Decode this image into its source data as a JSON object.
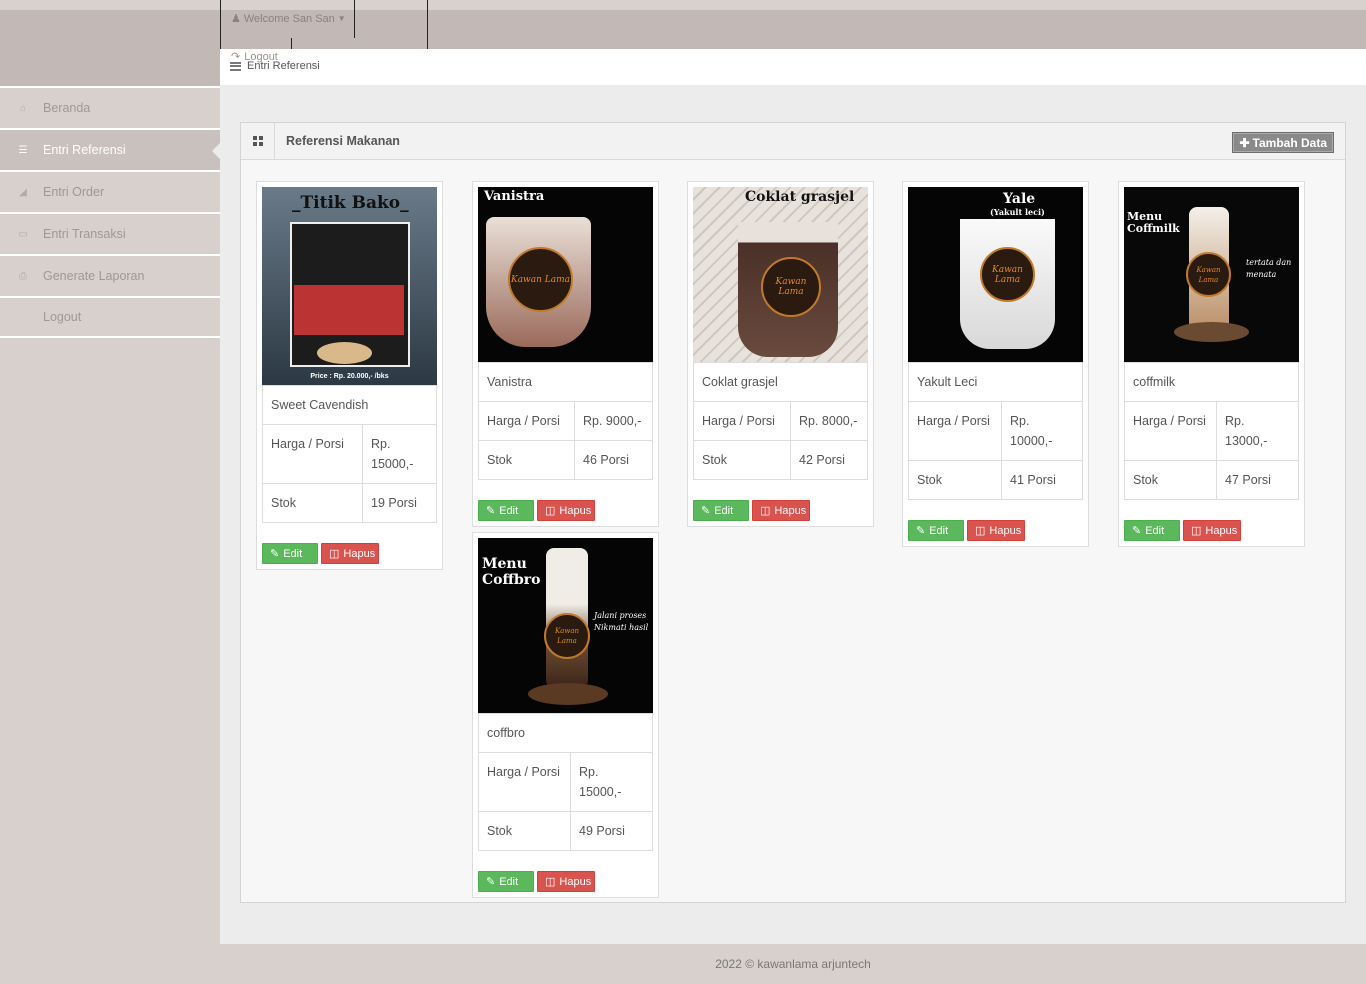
{
  "header": {
    "welcome": "Welcome San San",
    "logout": "Logout",
    "breadcrumb": "Entri Referensi"
  },
  "sidebar": {
    "items": [
      {
        "label": "Beranda",
        "icon": "home-icon"
      },
      {
        "label": "Entri Referensi",
        "icon": "list-icon",
        "active": true
      },
      {
        "label": "Entri Order",
        "icon": "cart-icon"
      },
      {
        "label": "Entri Transaksi",
        "icon": "inbox-icon"
      },
      {
        "label": "Generate Laporan",
        "icon": "print-icon"
      },
      {
        "label": "Logout",
        "icon": ""
      }
    ]
  },
  "panel": {
    "title": "Referensi Makanan",
    "add_label": "Tambah Data"
  },
  "products": [
    {
      "name": "Sweet Cavendish",
      "price_label": "Harga / Porsi",
      "price": "Rp. 15000,-",
      "stock_label": "Stok",
      "stock": "19 Porsi",
      "image_text": "_Titik Bako_",
      "image_caption": "Price : Rp. 20.000,- /bks"
    },
    {
      "name": "Vanistra",
      "price_label": "Harga / Porsi",
      "price": "Rp. 9000,-",
      "stock_label": "Stok",
      "stock": "46 Porsi",
      "image_text": "Vanistra"
    },
    {
      "name": "Coklat grasjel",
      "price_label": "Harga / Porsi",
      "price": "Rp. 8000,-",
      "stock_label": "Stok",
      "stock": "42 Porsi",
      "image_text": "Coklat grasjel"
    },
    {
      "name": "Yakult Leci",
      "price_label": "Harga / Porsi",
      "price": "Rp. 10000,-",
      "stock_label": "Stok",
      "stock": "41 Porsi",
      "image_text": "Yale",
      "image_sub": "(Yakult leci)"
    },
    {
      "name": "coffmilk",
      "price_label": "Harga / Porsi",
      "price": "Rp. 13000,-",
      "stock_label": "Stok",
      "stock": "47 Porsi",
      "image_text": "Menu Coffmilk",
      "image_side": "tertata dan menata"
    },
    {
      "name": "coffbro",
      "price_label": "Harga / Porsi",
      "price": "Rp. 15000,-",
      "stock_label": "Stok",
      "stock": "49 Porsi",
      "image_text": "Menu Coffbro",
      "image_side": "Jalani proses Nikmati hasil"
    }
  ],
  "buttons": {
    "edit": "Edit",
    "delete": "Hapus"
  },
  "brand_logo": "Kawan Lama",
  "footer": "2022 © kawanlama arjuntech",
  "colors": {
    "header": "#c2b9b6",
    "sidebar": "#d8d0cd",
    "edit": "#5cb85c",
    "delete": "#d9534f"
  }
}
